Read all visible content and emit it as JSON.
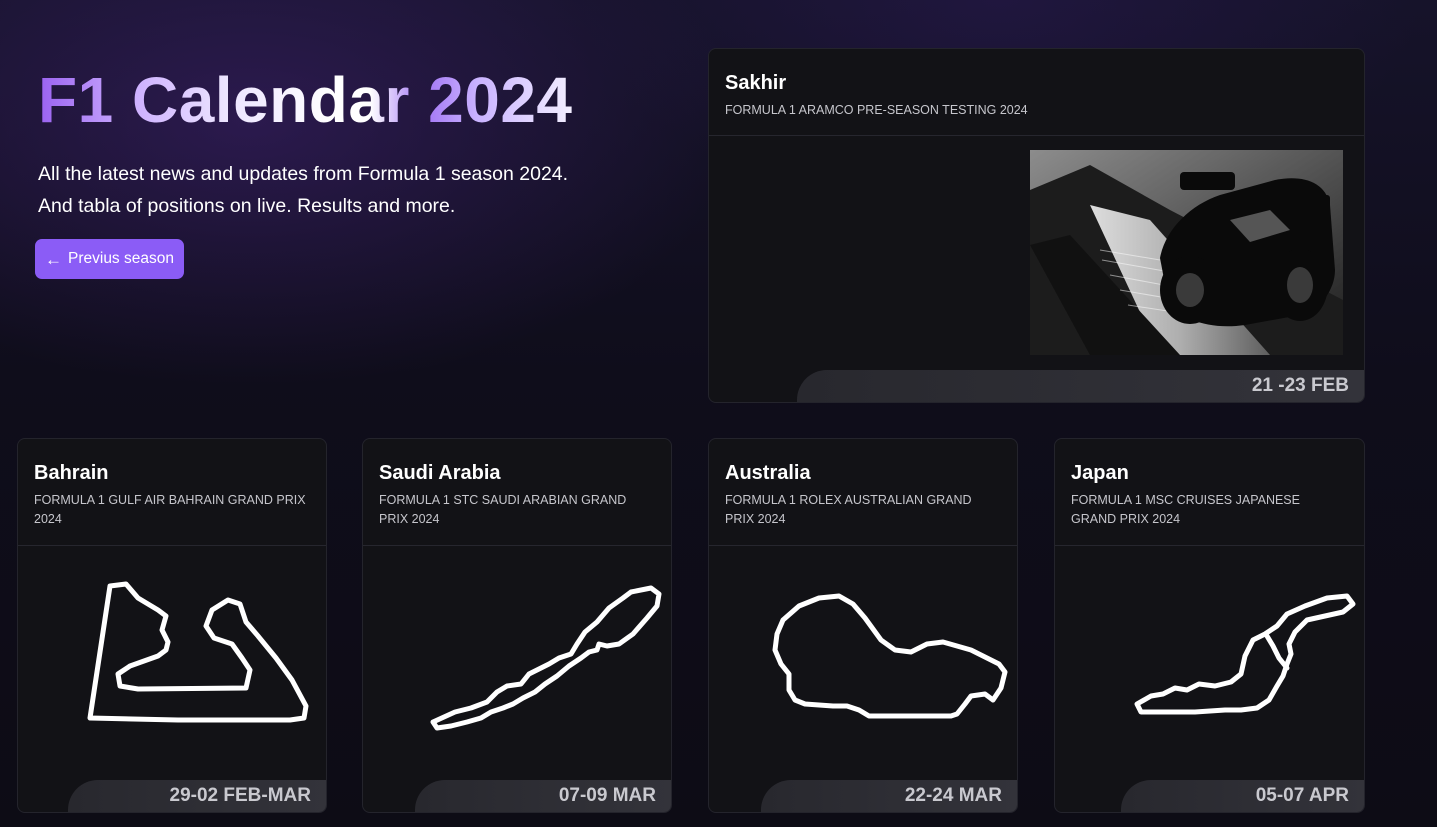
{
  "hero": {
    "title": "F1 Calendar 2024",
    "description_line1": "All the latest news and updates from Formula 1 season 2024.",
    "description_line2": "And tabla of positions on live. Results and more.",
    "prev_button_label": "Previus season",
    "prev_button_icon": "arrow-left-icon"
  },
  "featured": {
    "name": "Sakhir",
    "subtitle": "FORMULA 1 ARAMCO PRE-SEASON TESTING 2024",
    "date": "21 -23 FEB",
    "image": "f1-car-photo"
  },
  "races": [
    {
      "name": "Bahrain",
      "subtitle": "FORMULA 1 GULF AIR BAHRAIN GRAND PRIX 2024",
      "date": "29-02 FEB-MAR",
      "track_icon": "bahrain-circuit-icon"
    },
    {
      "name": "Saudi Arabia",
      "subtitle": "FORMULA 1 STC SAUDI ARABIAN GRAND PRIX 2024",
      "date": "07-09 MAR",
      "track_icon": "jeddah-circuit-icon"
    },
    {
      "name": "Australia",
      "subtitle": "FORMULA 1 ROLEX AUSTRALIAN GRAND PRIX 2024",
      "date": "22-24 MAR",
      "track_icon": "albert-park-circuit-icon"
    },
    {
      "name": "Japan",
      "subtitle": "FORMULA 1 MSC CRUISES JAPANESE GRAND PRIX 2024",
      "date": "05-07 APR",
      "track_icon": "suzuka-circuit-icon"
    }
  ],
  "colors": {
    "accent": "#8b5cf6",
    "card_bg": "#121216",
    "date_text": "#c9c9cf"
  }
}
